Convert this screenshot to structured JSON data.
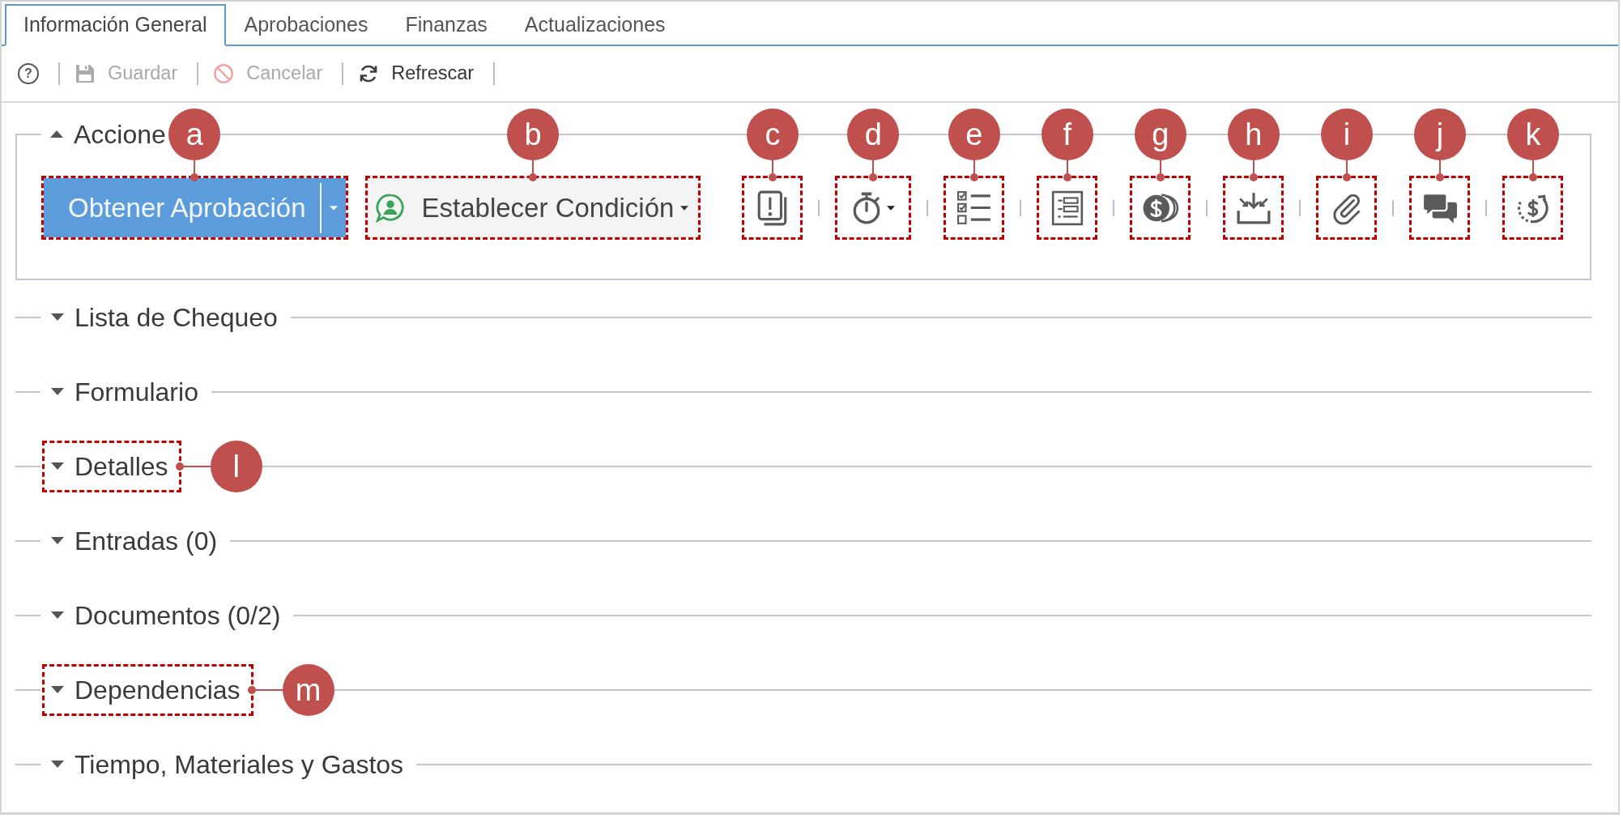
{
  "tabs": [
    {
      "label": "Información General",
      "selected": true
    },
    {
      "label": "Aprobaciones",
      "selected": false
    },
    {
      "label": "Finanzas",
      "selected": false
    },
    {
      "label": "Actualizaciones",
      "selected": false
    }
  ],
  "toolbar": [
    {
      "kind": "help",
      "label": "?",
      "disabled": false
    },
    {
      "kind": "save",
      "label": "Guardar",
      "disabled": true
    },
    {
      "kind": "cancel",
      "label": "Cancelar",
      "disabled": true
    },
    {
      "kind": "refresh",
      "label": "Refrescar",
      "disabled": false
    }
  ],
  "actions_panel": {
    "title": "Accione",
    "expanded": true,
    "buttons": [
      {
        "kind": "primary",
        "label": "Obtener Aprobación",
        "split": true,
        "dropdown": true,
        "callout": "a"
      },
      {
        "kind": "light",
        "label": "Establecer Condición",
        "split": false,
        "dropdown": true,
        "callout": "b"
      }
    ],
    "icons": [
      {
        "kind": "alert",
        "dropdown": false,
        "callout": "c"
      },
      {
        "kind": "stopwatch",
        "dropdown": true,
        "callout": "d"
      },
      {
        "kind": "checklist",
        "dropdown": false,
        "callout": "e"
      },
      {
        "kind": "form",
        "dropdown": false,
        "callout": "f"
      },
      {
        "kind": "coin",
        "dropdown": false,
        "callout": "g"
      },
      {
        "kind": "tray",
        "dropdown": false,
        "callout": "h"
      },
      {
        "kind": "paperclip",
        "dropdown": false,
        "callout": "i"
      },
      {
        "kind": "chat",
        "dropdown": false,
        "callout": "j"
      },
      {
        "kind": "recurring",
        "dropdown": false,
        "callout": "k"
      }
    ]
  },
  "sections": [
    {
      "title": "Lista de Chequeo",
      "expanded": false
    },
    {
      "title": "Formulario",
      "expanded": false
    },
    {
      "title": "Detalles",
      "expanded": false,
      "callout": "l"
    },
    {
      "title": "Entradas (0)",
      "expanded": false
    },
    {
      "title": "Documentos (0/2)",
      "expanded": false
    },
    {
      "title": "Dependencias",
      "expanded": false,
      "callout": "m"
    },
    {
      "title": "Tiempo, Materiales y Gastos",
      "expanded": false
    }
  ]
}
